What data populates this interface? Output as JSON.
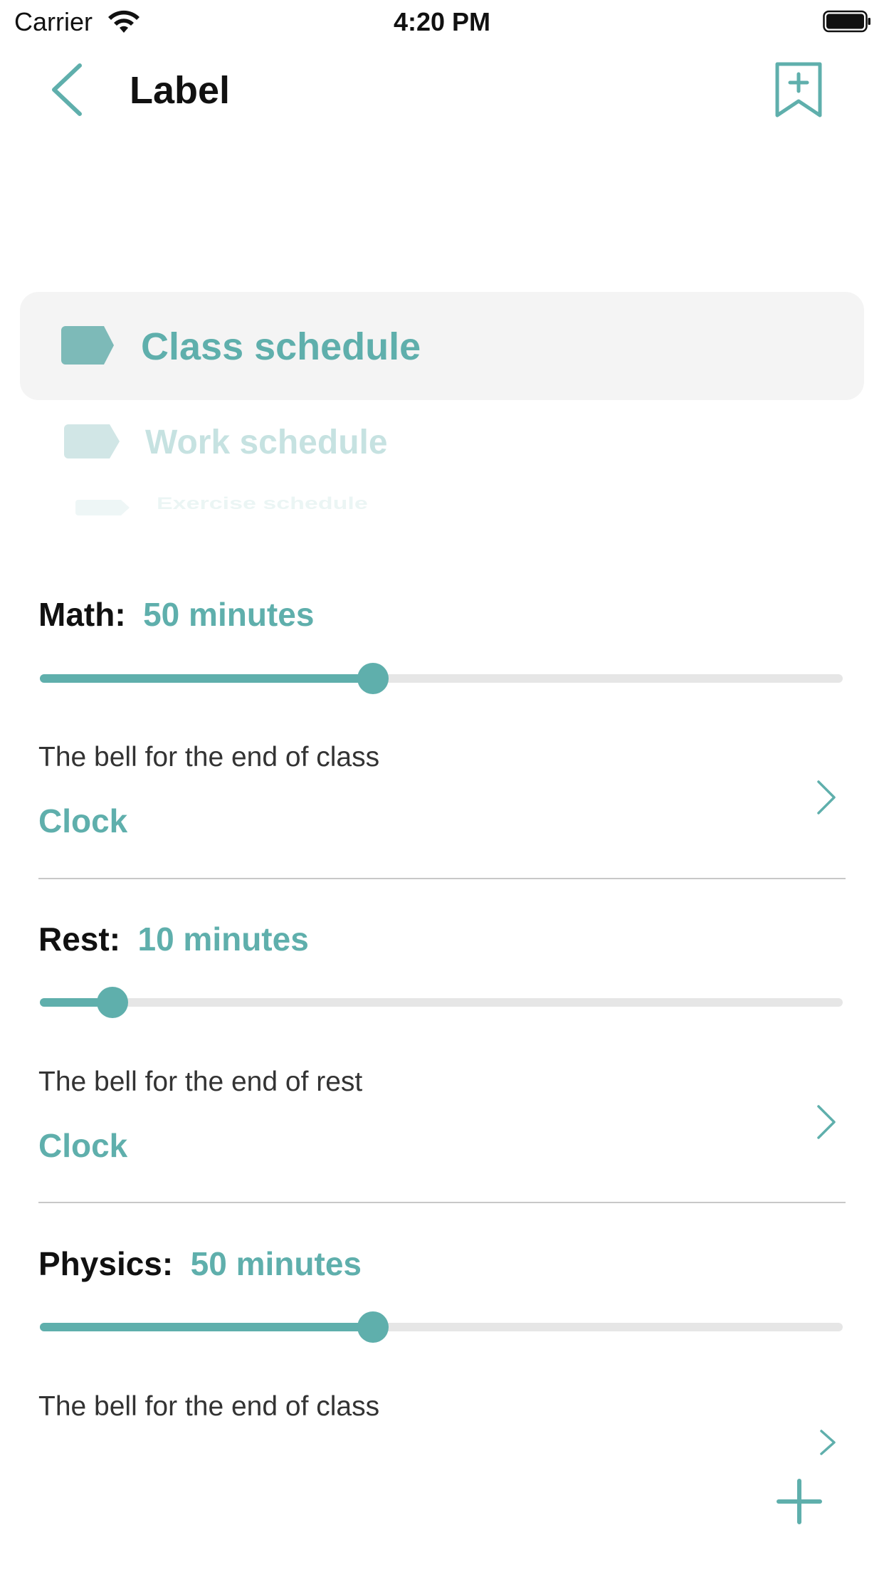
{
  "status_bar": {
    "carrier": "Carrier",
    "time": "4:20 PM"
  },
  "nav": {
    "title": "Label"
  },
  "picker": {
    "items": [
      {
        "label": "Class schedule"
      },
      {
        "label": "Work schedule"
      },
      {
        "label": "Exercise schedule"
      }
    ],
    "selected": "Class schedule"
  },
  "sections": [
    {
      "name": "Math:",
      "value": "50 minutes",
      "slider_fraction": 0.415,
      "bell_label": "The bell for the end of class",
      "bell_value": "Clock"
    },
    {
      "name": "Rest:",
      "value": "10 minutes",
      "slider_fraction": 0.09,
      "bell_label": "The bell for the end of rest",
      "bell_value": "Clock"
    },
    {
      "name": "Physics:",
      "value": "50 minutes",
      "slider_fraction": 0.415,
      "bell_label": "The bell for the end of class",
      "bell_value": ""
    }
  ],
  "colors": {
    "accent": "#5fafac",
    "track": "#e6e6e6",
    "highlight": "#f4f4f4"
  },
  "icons": [
    "back-chevron-icon",
    "bookmark-add-icon",
    "tag-icon",
    "chevron-right-icon",
    "plus-icon"
  ]
}
